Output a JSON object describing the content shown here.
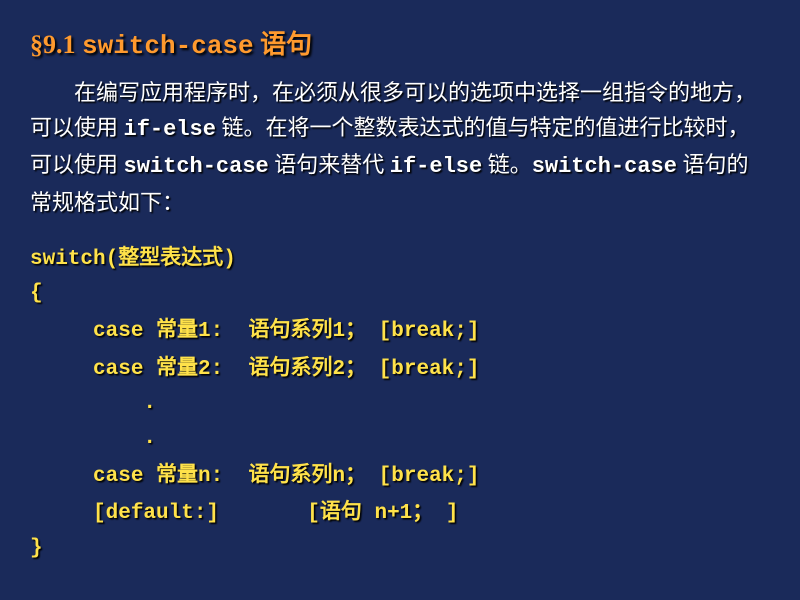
{
  "title": {
    "section": "§9.1",
    "code": "switch-case",
    "label": "语句"
  },
  "paragraph": {
    "indent": "　　",
    "t1": "在编写应用程序时，在必须从很多可以的选项中选择一组指令的地方，可以使用 ",
    "c1": "if-else",
    "t2": " 链。在将一个整数表达式的值与特定的值进行比较时，可以使用 ",
    "c2": "switch-case",
    "t3": " 语句来替代 ",
    "c3": "if-else",
    "t4": " 链。",
    "c4": "switch-case",
    "t5": " 语句的常规格式如下："
  },
  "code": {
    "l1a": "switch(",
    "l1b": "整型表达式",
    "l1c": ")",
    "l2": "{",
    "l3a": "     case ",
    "l3b": "常量",
    "l3c": "1:  ",
    "l3d": "语句系列",
    "l3e": "1",
    "l3f": "；",
    "l3g": " [break;]",
    "l4a": "     case ",
    "l4b": "常量",
    "l4c": "2:  ",
    "l4d": "语句系列",
    "l4e": "2",
    "l4f": "；",
    "l4g": " [break;]",
    "l5": "         .",
    "l6": "         .",
    "l7a": "     case ",
    "l7b": "常量",
    "l7c": "n:  ",
    "l7d": "语句系列",
    "l7e": "n",
    "l7f": "；",
    "l7g": " [break;]",
    "l8a": "     [default:]       [",
    "l8b": "语句",
    "l8c": " n+1",
    "l8d": "；",
    "l8e": " ]",
    "l9": "}"
  }
}
